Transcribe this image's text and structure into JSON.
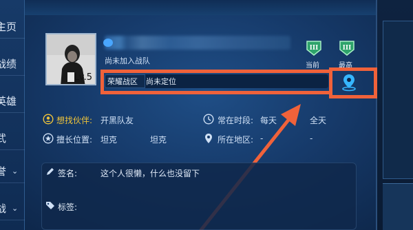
{
  "sidebar": {
    "items": [
      {
        "label": "主页"
      },
      {
        "label": "战绩"
      },
      {
        "label": "英雄"
      },
      {
        "label": "武"
      },
      {
        "label": "誉"
      },
      {
        "label": "战"
      }
    ]
  },
  "profile": {
    "level": "Lv.5",
    "team_status": "尚未加入战队",
    "rank_badges": [
      {
        "label": "当前",
        "rank": "III"
      },
      {
        "label": "最高",
        "rank": "III"
      }
    ],
    "zone": {
      "label": "荣耀战区",
      "value": "尚未定位"
    }
  },
  "info": {
    "partner": {
      "label": "想找伙伴:",
      "value": "开黑队友"
    },
    "active_time": {
      "label": "常在时段:",
      "value": "每天",
      "extra": "全天"
    },
    "position": {
      "label": "擅长位置:",
      "value": "坦克",
      "extra": "坦克"
    },
    "region": {
      "label": "所在地区:",
      "value": "-",
      "extra": "-"
    }
  },
  "signature": {
    "label": "签名:",
    "text": "这个人很懒，什么也没留下"
  },
  "tags": {
    "label": "标签:"
  },
  "colors": {
    "highlight": "#f0623a",
    "accent_yellow": "#f0c43a",
    "location_icon": "#36b6ff"
  }
}
